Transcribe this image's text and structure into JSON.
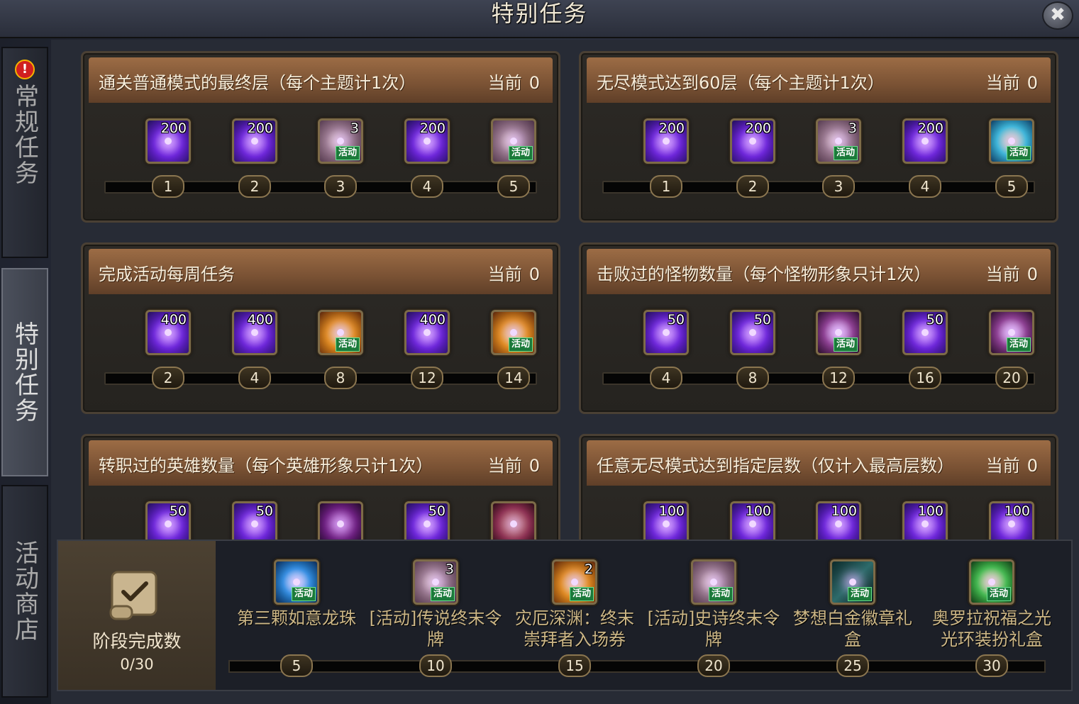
{
  "window": {
    "title": "特别任务",
    "close_label": "✖"
  },
  "sidebar": {
    "alert": "!",
    "tabs": [
      {
        "label": "常规任务",
        "active": false
      },
      {
        "label": "特别任务",
        "active": true
      },
      {
        "label": "活动商店",
        "active": false
      }
    ]
  },
  "current_label": "当前",
  "tasks": [
    {
      "title": "通关普通模式的最终层（每个主题计1次）",
      "current": "0",
      "rewards": [
        {
          "icon": "crystal",
          "qty": "200"
        },
        {
          "icon": "crystal",
          "qty": "200"
        },
        {
          "icon": "token",
          "qty": "3",
          "tag": "活动"
        },
        {
          "icon": "crystal",
          "qty": "200"
        },
        {
          "icon": "token",
          "tag": "活动"
        }
      ],
      "milestones": [
        "1",
        "2",
        "3",
        "4",
        "5"
      ]
    },
    {
      "title": "无尽模式达到60层（每个主题计1次）",
      "current": "0",
      "rewards": [
        {
          "icon": "crystal",
          "qty": "200"
        },
        {
          "icon": "crystal",
          "qty": "200"
        },
        {
          "icon": "token",
          "qty": "3",
          "tag": "活动"
        },
        {
          "icon": "crystal",
          "qty": "200"
        },
        {
          "icon": "chest-blue",
          "tag": "活动"
        }
      ],
      "milestones": [
        "1",
        "2",
        "3",
        "4",
        "5"
      ]
    },
    {
      "title": "完成活动每周任务",
      "current": "0",
      "rewards": [
        {
          "icon": "crystal",
          "qty": "400"
        },
        {
          "icon": "crystal",
          "qty": "400"
        },
        {
          "icon": "gold",
          "tag": "活动"
        },
        {
          "icon": "crystal",
          "qty": "400"
        },
        {
          "icon": "gold",
          "tag": "活动"
        }
      ],
      "milestones": [
        "2",
        "4",
        "8",
        "12",
        "14"
      ]
    },
    {
      "title": "击败过的怪物数量（每个怪物形象只计1次）",
      "current": "0",
      "rewards": [
        {
          "icon": "crystal",
          "qty": "50"
        },
        {
          "icon": "crystal",
          "qty": "50"
        },
        {
          "icon": "chest-pink",
          "tag": "活动"
        },
        {
          "icon": "crystal",
          "qty": "50"
        },
        {
          "icon": "chest-pink",
          "tag": "活动"
        }
      ],
      "milestones": [
        "4",
        "8",
        "12",
        "16",
        "20"
      ]
    },
    {
      "title": "转职过的英雄数量（每个英雄形象只计1次）",
      "current": "0",
      "rewards": [
        {
          "icon": "crystal",
          "qty": "50"
        },
        {
          "icon": "crystal",
          "qty": "50"
        },
        {
          "icon": "box-purple"
        },
        {
          "icon": "crystal",
          "qty": "50"
        },
        {
          "icon": "box-red"
        }
      ],
      "milestones": []
    },
    {
      "title": "任意无尽模式达到指定层数（仅计入最高层数）",
      "current": "0",
      "rewards": [
        {
          "icon": "crystal",
          "qty": "100"
        },
        {
          "icon": "crystal",
          "qty": "100"
        },
        {
          "icon": "crystal",
          "qty": "100"
        },
        {
          "icon": "crystal",
          "qty": "100"
        },
        {
          "icon": "crystal",
          "qty": "100"
        }
      ],
      "milestones": []
    }
  ],
  "stage": {
    "label": "阶段完成数",
    "count": "0/30",
    "rewards": [
      {
        "icon": "orb",
        "tag": "活动",
        "name": "第三颗如意龙珠",
        "milestone": "5"
      },
      {
        "icon": "token",
        "qty": "3",
        "tag": "活动",
        "name": "[活动]传说终末令牌",
        "milestone": "10"
      },
      {
        "icon": "gold",
        "qty": "2",
        "tag": "活动",
        "name": "灾厄深渊：终末崇拜者入场券",
        "milestone": "15"
      },
      {
        "icon": "token",
        "tag": "活动",
        "name": "[活动]史诗终末令牌",
        "milestone": "20"
      },
      {
        "icon": "dagger",
        "tag": "活动",
        "name": "梦想白金徽章礼盒",
        "milestone": "25"
      },
      {
        "icon": "chest-green",
        "tag": "活动",
        "name": "奥罗拉祝福之光光环装扮礼盒",
        "milestone": "30"
      }
    ]
  }
}
